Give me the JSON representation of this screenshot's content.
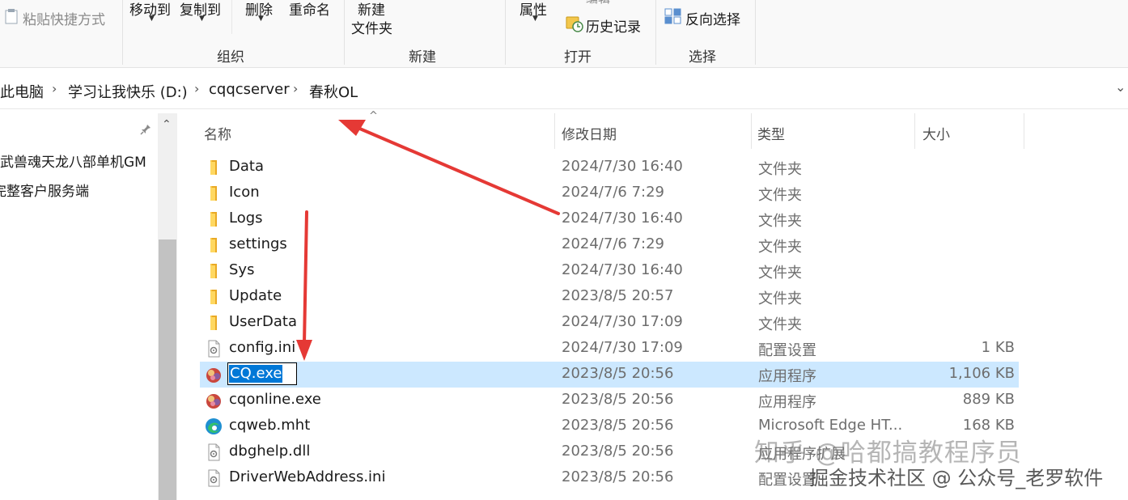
{
  "ribbon": {
    "paste_shortcut": "粘贴快捷方式",
    "move_to": "移动到",
    "copy_to": "复制到",
    "delete": "删除",
    "rename": "重命名",
    "new_folder_line1": "新建",
    "new_folder_line2": "文件夹",
    "properties": "属性",
    "edit_partial": "编辑",
    "history": "历史记录",
    "invert_selection": "反向选择",
    "groups": {
      "organize": "组织",
      "new": "新建",
      "open": "打开",
      "select": "选择"
    }
  },
  "address": {
    "crumbs": [
      "此电脑",
      "学习让我快乐 (D:)",
      "cqqcserver",
      "春秋OL"
    ]
  },
  "nav": {
    "items": [
      "武兽魂天龙八部单机GM",
      "完整客户服务端"
    ]
  },
  "columns": {
    "name": "名称",
    "date": "修改日期",
    "type": "类型",
    "size": "大小"
  },
  "files": [
    {
      "name": "Data",
      "date": "2024/7/30 16:40",
      "type": "文件夹",
      "size": "",
      "icon": "folder-icon"
    },
    {
      "name": "Icon",
      "date": "2024/7/6 7:29",
      "type": "文件夹",
      "size": "",
      "icon": "folder-icon"
    },
    {
      "name": "Logs",
      "date": "2024/7/30 16:40",
      "type": "文件夹",
      "size": "",
      "icon": "folder-icon"
    },
    {
      "name": "settings",
      "date": "2024/7/6 7:29",
      "type": "文件夹",
      "size": "",
      "icon": "folder-icon"
    },
    {
      "name": "Sys",
      "date": "2024/7/30 16:40",
      "type": "文件夹",
      "size": "",
      "icon": "folder-icon"
    },
    {
      "name": "Update",
      "date": "2023/8/5 20:57",
      "type": "文件夹",
      "size": "",
      "icon": "folder-icon"
    },
    {
      "name": "UserData",
      "date": "2024/7/30 17:09",
      "type": "文件夹",
      "size": "",
      "icon": "folder-icon"
    },
    {
      "name": "config.ini",
      "date": "2024/7/30 17:09",
      "type": "配置设置",
      "size": "1 KB",
      "icon": "settings-file-icon"
    },
    {
      "name": "CQ.exe",
      "date": "2023/8/5 20:56",
      "type": "应用程序",
      "size": "1,106 KB",
      "icon": "app-icon",
      "selected": true
    },
    {
      "name": "cqonline.exe",
      "date": "2023/8/5 20:56",
      "type": "应用程序",
      "size": "889 KB",
      "icon": "app-icon"
    },
    {
      "name": "cqweb.mht",
      "date": "2023/8/5 20:56",
      "type": "Microsoft Edge HT...",
      "size": "168 KB",
      "icon": "edge-icon"
    },
    {
      "name": "dbghelp.dll",
      "date": "2023/8/5 20:56",
      "type": "应用程序扩展",
      "size": "",
      "icon": "dll-file-icon"
    },
    {
      "name": "DriverWebAddress.ini",
      "date": "2023/8/5 20:56",
      "type": "配置设置",
      "size": "",
      "icon": "settings-file-icon"
    }
  ],
  "watermark": {
    "line1": "知乎 @哈都搞教程序员",
    "line2": "掘金技术社区 @ 公众号_老罗软件"
  },
  "colors": {
    "selection": "#cce8ff",
    "folder": "#f8c542",
    "arrow": "#e53935"
  }
}
